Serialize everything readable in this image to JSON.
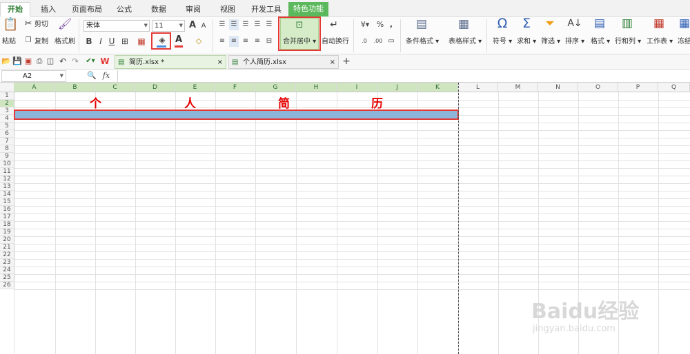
{
  "menu_tabs": [
    {
      "id": "home",
      "label": "开始"
    },
    {
      "id": "insert",
      "label": "插入"
    },
    {
      "id": "layout",
      "label": "页面布局"
    },
    {
      "id": "formula",
      "label": "公式"
    },
    {
      "id": "data",
      "label": "数据"
    },
    {
      "id": "review",
      "label": "审阅"
    },
    {
      "id": "view",
      "label": "视图"
    },
    {
      "id": "dev",
      "label": "开发工具"
    },
    {
      "id": "special",
      "label": "特色功能"
    }
  ],
  "ribbon": {
    "paste": "粘贴",
    "cut": "剪切",
    "copy": "复制",
    "format_painter": "格式刷",
    "font_name": "宋体",
    "font_size": "11",
    "bold": "B",
    "italic": "I",
    "underline": "U",
    "font_grow": "A",
    "font_shrink": "A",
    "merge_center": "合并居中",
    "wrap_text": "自动换行",
    "percent": "%",
    "comma": ",",
    "cond_format": "条件格式",
    "table_style": "表格样式",
    "symbol": "符号",
    "sum": "求和",
    "filter": "筛选",
    "sort": "排序",
    "format": "格式",
    "row_col": "行和列",
    "worksheet": "工作表",
    "freeze": "冻结"
  },
  "colors": {
    "accent": "#5cb85c",
    "highlight_red": "#e53935",
    "title_red": "#e60000",
    "selection": "#8db4d9"
  },
  "doc_tabs": [
    {
      "name": "简历.xlsx *",
      "active": true
    },
    {
      "name": "个人简历.xlsx",
      "active": false
    }
  ],
  "formula_bar": {
    "cell_ref": "A2",
    "fx": "fx",
    "value": ""
  },
  "columns": [
    "A",
    "B",
    "C",
    "D",
    "E",
    "F",
    "G",
    "H",
    "I",
    "J",
    "K",
    "L",
    "M",
    "N",
    "O",
    "P",
    "Q"
  ],
  "rows": [
    "1",
    "2",
    "3",
    "4",
    "5",
    "6",
    "7",
    "8",
    "9",
    "10",
    "11",
    "12",
    "13",
    "14",
    "15",
    "16",
    "17",
    "18",
    "19",
    "20",
    "21",
    "22",
    "23",
    "24",
    "25",
    "26"
  ],
  "sheet": {
    "title_chars": [
      "个",
      "人",
      "简",
      "历"
    ]
  },
  "watermark": {
    "logo": "Baidu经验",
    "url": "jingyan.baidu.com"
  }
}
